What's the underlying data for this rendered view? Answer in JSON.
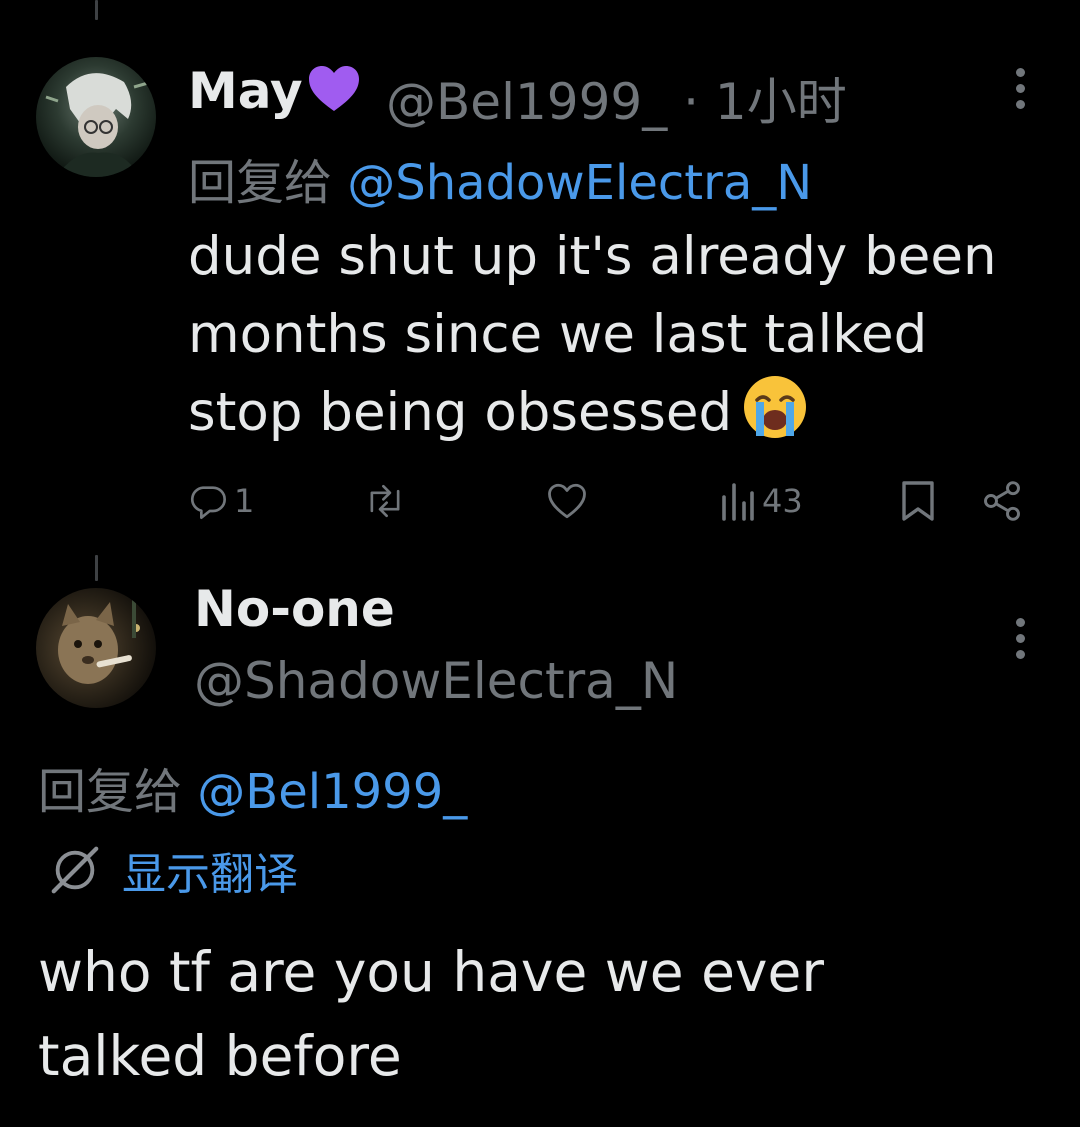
{
  "post1": {
    "author_name": "May",
    "author_handle": "@Bel1999_",
    "separator": "·",
    "timestamp": "1小时",
    "reply_prefix": "回复给",
    "reply_mention": "@ShadowElectra_N",
    "text_lines": [
      "dude shut up it's already been",
      "months since we last talked",
      "stop being obsessed"
    ],
    "emoji": "loudly-crying-face",
    "heart_emoji_color": "#a05cf0",
    "actions": {
      "reply_count": "1",
      "repost_count": "",
      "like_count": "",
      "views_count": "43"
    }
  },
  "post2": {
    "author_name": "No-one",
    "author_handle": "@ShadowElectra_N",
    "reply_prefix": "回复给",
    "reply_mention": "@Bel1999_",
    "translate_label": "显示翻译",
    "text_lines": [
      "who tf are you have we ever",
      "talked before"
    ]
  },
  "colors": {
    "background": "#000000",
    "primary_text": "#e7e9ea",
    "secondary_text": "#71767b",
    "link": "#4a99e9"
  }
}
